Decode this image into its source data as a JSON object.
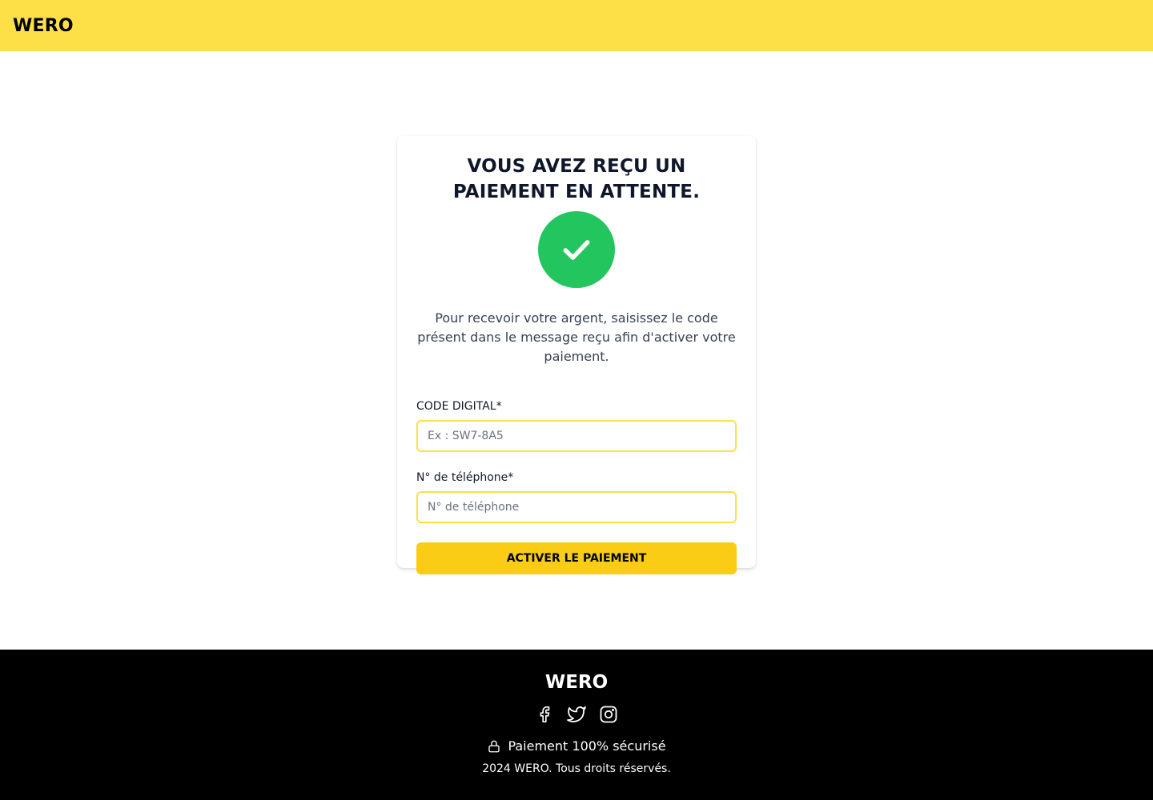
{
  "header": {
    "logo": "WERO"
  },
  "card": {
    "title": "VOUS AVEZ REÇU UN PAIEMENT EN ATTENTE.",
    "icon": "check-circle-icon",
    "description": "Pour recevoir votre argent, saisissez le code présent dans le message reçu afin d'activer votre paiement.",
    "code_field": {
      "label": "CODE DIGITAL*",
      "placeholder": "Ex : SW7-8A5",
      "value": ""
    },
    "phone_field": {
      "label": "N° de téléphone*",
      "placeholder": "N° de téléphone",
      "value": ""
    },
    "submit_label": "ACTIVER LE PAIEMENT"
  },
  "footer": {
    "logo": "WERO",
    "social": [
      "facebook-icon",
      "twitter-icon",
      "instagram-icon"
    ],
    "secure_text": "Paiement 100% sécurisé",
    "copyright": "2024 WERO. Tous droits réservés."
  },
  "colors": {
    "header_bg": "#fde047",
    "button_bg": "#facc15",
    "success": "#22c55e",
    "footer_bg": "#000000"
  }
}
